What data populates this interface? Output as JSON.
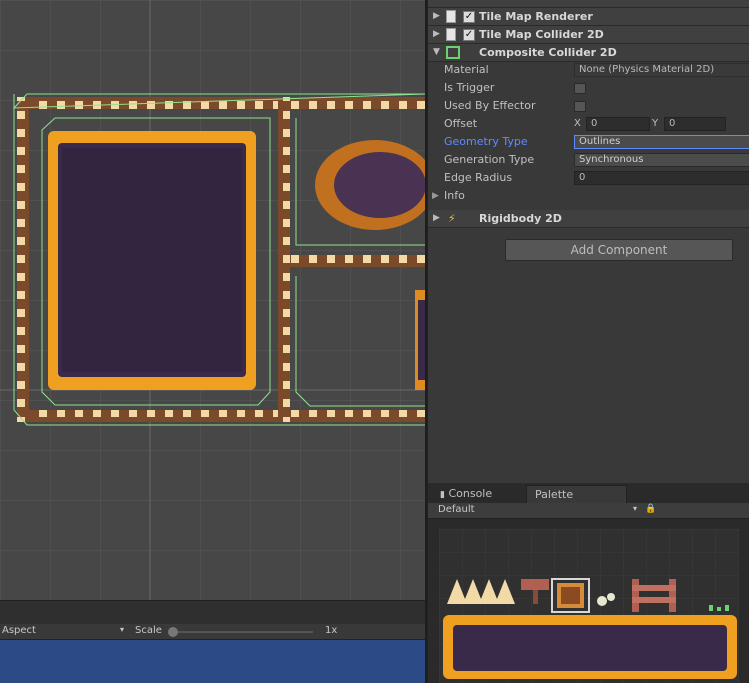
{
  "inspector": {
    "components": [
      {
        "title": "Tile Map Renderer",
        "checked": true
      },
      {
        "title": "Tile Map Collider 2D",
        "checked": true
      }
    ],
    "composite": {
      "title": "Composite Collider 2D",
      "props": {
        "material_label": "Material",
        "material_value": "None (Physics Material 2D)",
        "is_trigger_label": "Is Trigger",
        "used_by_effector_label": "Used By Effector",
        "offset_label": "Offset",
        "offset_x_label": "X",
        "offset_x_value": "0",
        "offset_y_label": "Y",
        "offset_y_value": "0",
        "geometry_type_label": "Geometry Type",
        "geometry_type_value": "Outlines",
        "generation_type_label": "Generation Type",
        "generation_type_value": "Synchronous",
        "edge_radius_label": "Edge Radius",
        "edge_radius_value": "0",
        "info_label": "Info"
      }
    },
    "rigidbody": {
      "title": "Rigidbody 2D"
    },
    "add_component_label": "Add Component"
  },
  "bottom_tabs": {
    "console": "Console",
    "palette": "Palette"
  },
  "palette_bar": {
    "selected": "Default"
  },
  "game_toolbar": {
    "aspect": "Aspect",
    "scale_label": "Scale",
    "scale_value": "1x"
  },
  "colors": {
    "accent_blue": "#5e8cff",
    "lava_orange": "#f0a020",
    "dark_purple": "#3a2a4a",
    "collider_green": "#7fe07f"
  }
}
